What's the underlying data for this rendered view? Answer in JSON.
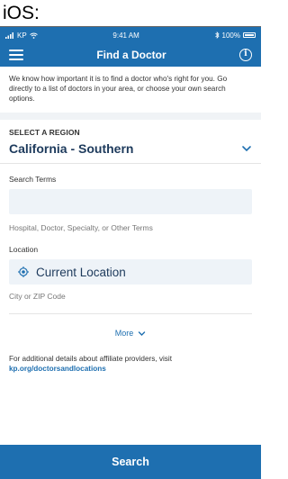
{
  "caption": "iOS:",
  "status_bar": {
    "carrier": "KP",
    "time": "9:41 AM",
    "battery": "100%"
  },
  "nav": {
    "title": "Find a Doctor",
    "menu_icon": "hamburger-icon",
    "info_icon": "info-icon"
  },
  "intro_text": "We know how important it is to find a doctor who's right for you. Go directly to a list of doctors in your area, or choose your own search options.",
  "region": {
    "label": "SELECT A REGION",
    "value": "California - Southern"
  },
  "search_terms": {
    "label": "Search Terms",
    "value": "",
    "hint": "Hospital, Doctor, Specialty, or Other Terms"
  },
  "location": {
    "label": "Location",
    "value": "Current Location",
    "hint": "City or ZIP Code"
  },
  "more_label": "More",
  "affiliate": {
    "text": "For additional details about affiliate providers, visit",
    "link": "kp.org/doctorsandlocations"
  },
  "search_button": "Search",
  "colors": {
    "brand_blue": "#1e6fb0",
    "input_bg": "#eef3f8",
    "region_text": "#1d3a5c"
  }
}
